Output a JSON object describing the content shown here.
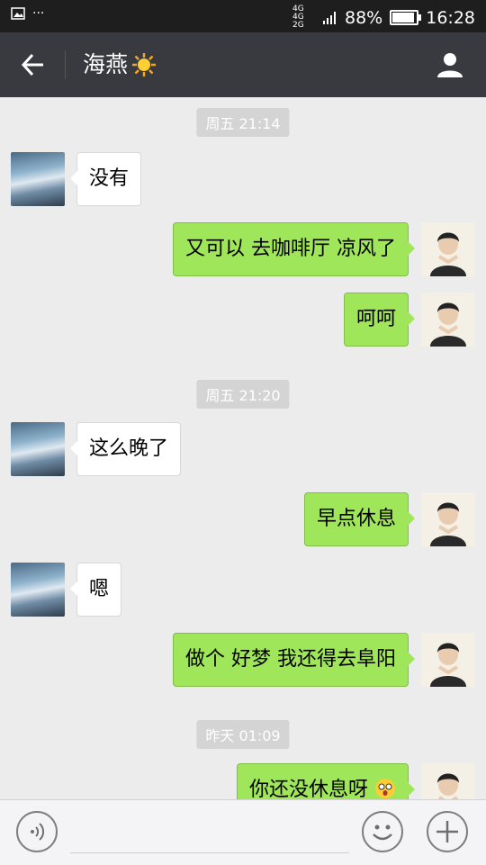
{
  "status_bar": {
    "battery": "88%",
    "time": "16:28",
    "network": "4G 4G 2G"
  },
  "header": {
    "title": "海燕"
  },
  "timestamps": [
    "周五 21:14",
    "周五 21:20",
    "昨天 01:09"
  ],
  "messages": [
    {
      "side": "left",
      "text": "没有"
    },
    {
      "side": "right",
      "text": "又可以 去咖啡厅 凉风了"
    },
    {
      "side": "right",
      "text": "呵呵"
    },
    {
      "side": "left",
      "text": "这么晚了"
    },
    {
      "side": "right",
      "text": "早点休息"
    },
    {
      "side": "left",
      "text": "嗯"
    },
    {
      "side": "right",
      "text": "做个 好梦 我还得去阜阳"
    },
    {
      "side": "right",
      "text": "你还没休息呀"
    }
  ],
  "icons": {
    "status": [
      "image-icon",
      "more-dots-icon",
      "signal-icon",
      "battery-icon"
    ],
    "header": [
      "back-arrow-icon",
      "sun-emoji-icon",
      "contact-profile-icon"
    ],
    "input_bar": [
      "voice-icon",
      "emoji-icon",
      "plus-icon"
    ]
  },
  "colors": {
    "title_bar": "#393a3f",
    "sent_bubble": "#9fe65a",
    "received_bubble": "#ffffff",
    "chat_bg": "#ececec"
  }
}
